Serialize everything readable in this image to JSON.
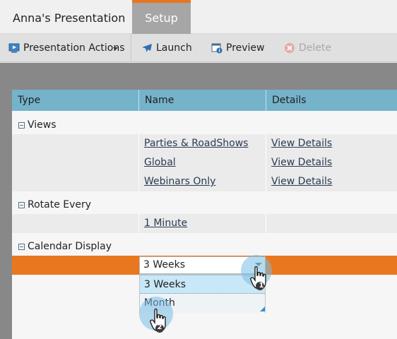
{
  "tabs": {
    "presentation_label": "Anna's Presentation",
    "setup_label": "Setup"
  },
  "toolbar": {
    "actions_label": "Presentation Actions",
    "launch_label": "Launch",
    "preview_label": "Preview",
    "delete_label": "Delete"
  },
  "grid": {
    "columns": [
      "Type",
      "Name",
      "Details"
    ],
    "groups": {
      "views": {
        "label": "Views",
        "rows": [
          {
            "name": "Parties & RoadShows",
            "details": "View Details"
          },
          {
            "name": "Global",
            "details": "View Details"
          },
          {
            "name": "Webinars Only",
            "details": "View Details"
          }
        ]
      },
      "rotate": {
        "label": "Rotate Every",
        "rows": [
          {
            "name": "1 Minute"
          }
        ]
      },
      "calendar": {
        "label": "Calendar Display",
        "current_value": "3 Weeks",
        "options": [
          "3 Weeks",
          "Month"
        ]
      }
    }
  },
  "callouts": {
    "step1": "1",
    "step2": "2"
  },
  "colors": {
    "accent_orange": "#e8771f",
    "header_blue": "#75b3cb",
    "link": "#2a3b53"
  }
}
